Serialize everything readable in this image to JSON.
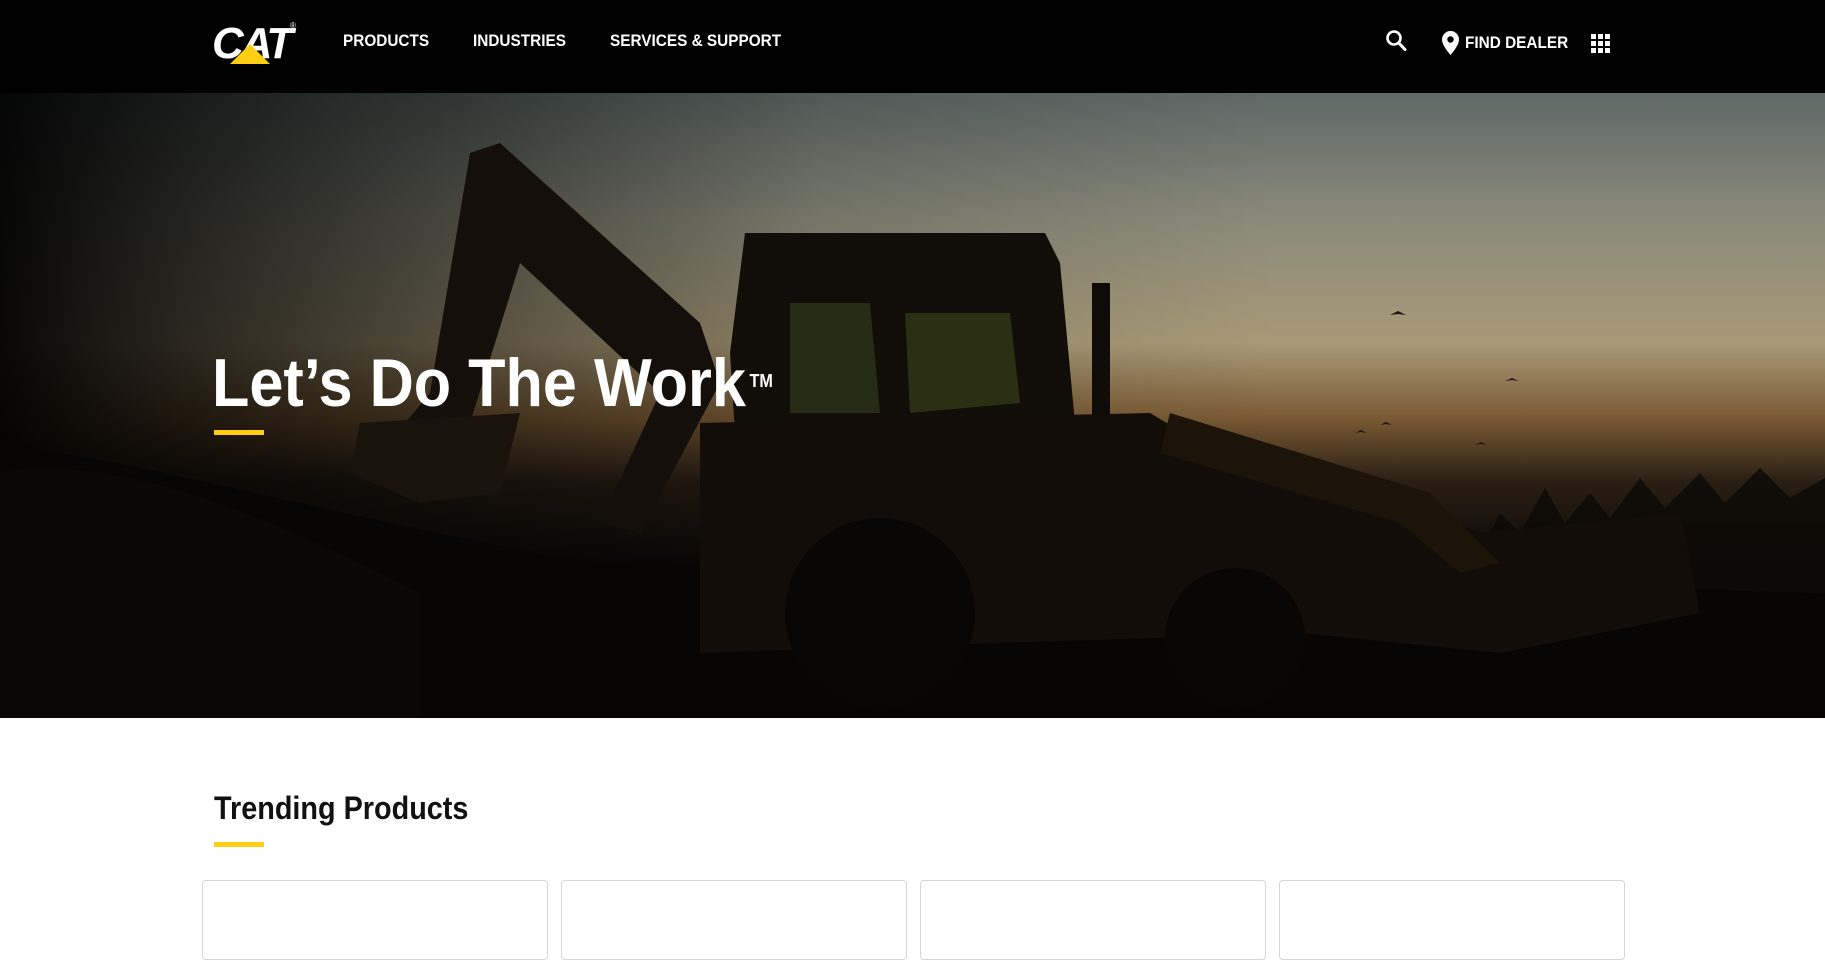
{
  "header": {
    "logo_text": "CAT",
    "logo_reg": "®",
    "nav": [
      {
        "label": "PRODUCTS"
      },
      {
        "label": "INDUSTRIES"
      },
      {
        "label": "SERVICES & SUPPORT"
      }
    ],
    "search_icon": "search-icon",
    "find_dealer_label": "FIND DEALER",
    "find_dealer_icon": "location-pin-icon",
    "apps_icon": "grid-menu-icon"
  },
  "hero": {
    "title": "Let’s Do The Work",
    "trademark": "TM",
    "accent_color": "#ffcd11"
  },
  "trending": {
    "title": "Trending Products",
    "cards": [
      {},
      {},
      {},
      {}
    ]
  },
  "colors": {
    "header_bg": "#000000",
    "accent": "#ffcd11",
    "text_light": "#ffffff"
  }
}
